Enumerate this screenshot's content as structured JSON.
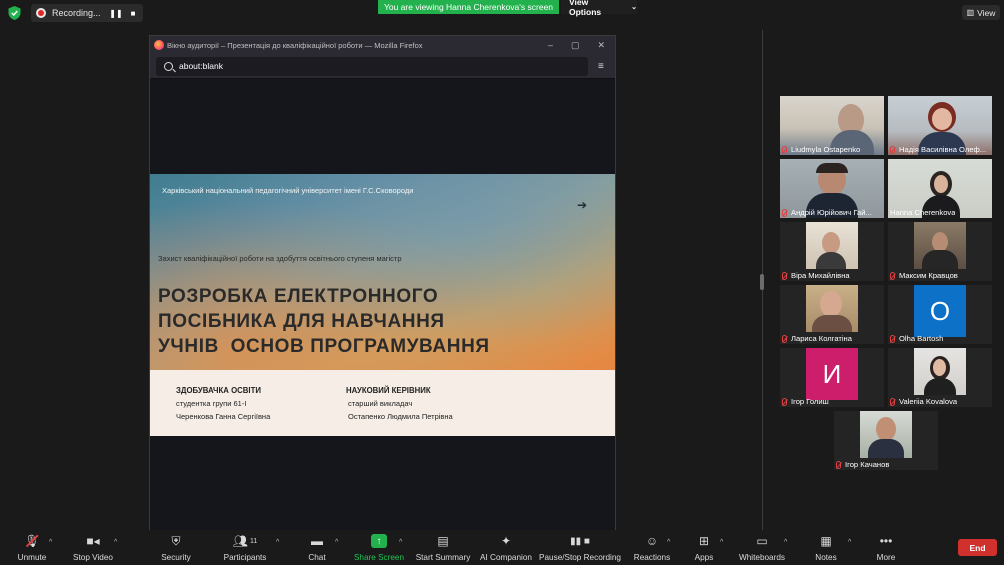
{
  "top_bar": {
    "recording_label": "Recording...",
    "viewing_banner": "You are viewing Hanna Cherenkova's screen",
    "view_options_label": "View Options",
    "view_button_label": "View"
  },
  "browser": {
    "window_title": "Вікно аудиторії – Презентація до кваліфікаційної роботи — Mozilla Firefox",
    "url": "about:blank"
  },
  "slide": {
    "university": "Харківський національний педагогічний університет імені Г.С.Сковороди",
    "subtitle": "Захист кваліфікаційної роботи на здобуття освітнього ступеня магістр",
    "title_line1": "Розробка електронного",
    "title_line2": "посібника для навчання",
    "title_line3": "учнів  основ програмування",
    "col1_heading": "ЗДОБУВАЧКА ОСВІТИ",
    "col1_line1": "студентка групи 61-І",
    "col1_line2": "Черенкова Ганна Сергіївна",
    "col2_heading": "НАУКОВИЙ КЕРІВНИК",
    "col2_line1": "старший викладач",
    "col2_line2": "Остапенко Людмила Петрівна"
  },
  "participants": [
    {
      "name": "Liudmyla Ostapenko"
    },
    {
      "name": "Надія Василівна Олеф..."
    },
    {
      "name": "Андрій Юрійович Гай..."
    },
    {
      "name": "Hanna Cherenkova"
    },
    {
      "name": "Віра Михайлівна"
    },
    {
      "name": "Максим Кравцов"
    },
    {
      "name": "Лариса Колгатіна"
    },
    {
      "name": "Olha Bartosh",
      "avatar_letter": "O",
      "avatar_color": "#0e71c8"
    },
    {
      "name": "Ігор Голиш",
      "avatar_letter": "И",
      "avatar_color": "#cc1e6a"
    },
    {
      "name": "Valeriia Kovalova"
    },
    {
      "name": "Ігор Качанов"
    }
  ],
  "toolbar": {
    "unmute": "Unmute",
    "stop_video": "Stop Video",
    "security": "Security",
    "participants": "Participants",
    "participants_count": "11",
    "chat": "Chat",
    "share_screen": "Share Screen",
    "start_summary": "Start Summary",
    "ai_companion": "AI Companion",
    "pause_stop_recording": "Pause/Stop Recording",
    "reactions": "Reactions",
    "apps": "Apps",
    "whiteboards": "Whiteboards",
    "notes": "Notes",
    "more": "More",
    "end": "End"
  },
  "colors": {
    "accent_green": "#23b14d",
    "end_red": "#d0312d",
    "active_speaker": "#c4d84b"
  }
}
